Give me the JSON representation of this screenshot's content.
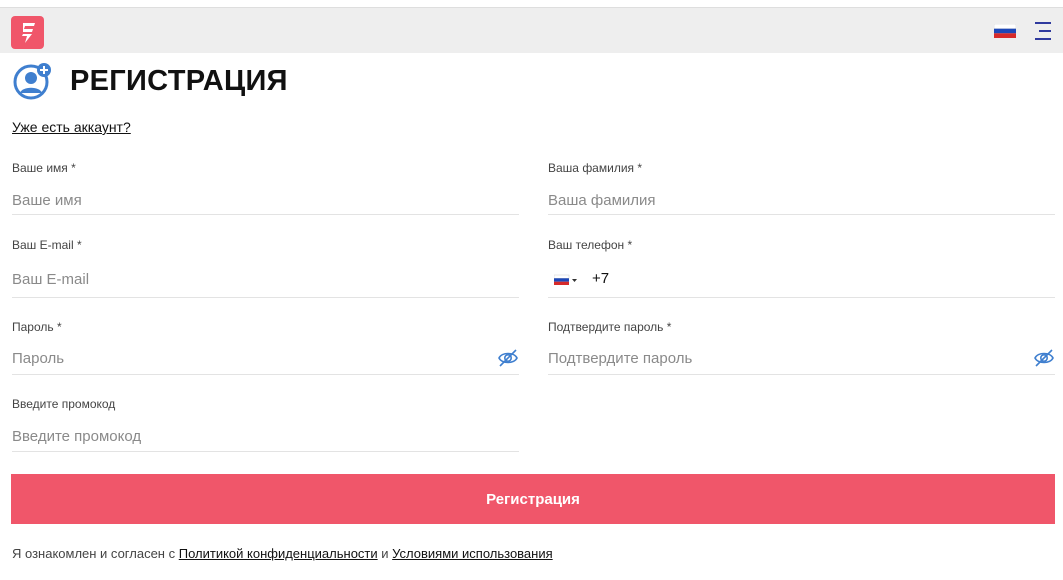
{
  "header": {
    "logo_icon": "logo-icon",
    "language_flag_icon": "russia-flag-icon",
    "menu_icon": "menu-icon",
    "accent_color": "#f0566a"
  },
  "page": {
    "title": "РЕГИСТРАЦИЯ",
    "title_icon": "user-plus-icon",
    "login_link": "Уже есть аккаунт?"
  },
  "form": {
    "first_name": {
      "label": "Ваше имя *",
      "placeholder": "Ваше имя",
      "value": ""
    },
    "last_name": {
      "label": "Ваша фамилия *",
      "placeholder": "Ваша фамилия",
      "value": ""
    },
    "email": {
      "label": "Ваш E-mail *",
      "placeholder": "Ваш E-mail",
      "value": ""
    },
    "phone": {
      "label": "Ваш телефон *",
      "country_code": "+7",
      "value": "",
      "flag_icon": "russia-flag-icon"
    },
    "password": {
      "label": "Пароль *",
      "placeholder": "Пароль",
      "value": "",
      "toggle_icon": "eye-off-icon"
    },
    "password_confirm": {
      "label": "Подтвердите пароль *",
      "placeholder": "Подтвердите пароль",
      "value": "",
      "toggle_icon": "eye-off-icon"
    },
    "promo": {
      "label": "Введите промокод",
      "placeholder": "Введите промокод",
      "value": ""
    },
    "submit_label": "Регистрация"
  },
  "consent": {
    "prefix": "Я ознакомлен и согласен с",
    "privacy_link": "Политикой конфиденциальности",
    "conjunction": "и",
    "terms_link": "Условиями использования"
  }
}
